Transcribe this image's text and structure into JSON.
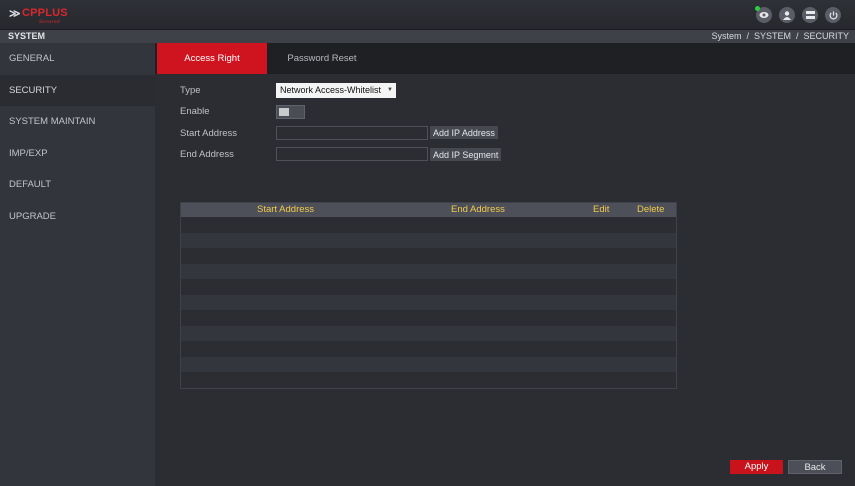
{
  "brand": {
    "logo_text": "CPPLUS",
    "logo_sub": "Secured"
  },
  "header": {
    "icons": [
      "eye-icon",
      "user-icon",
      "network-icon",
      "power-icon"
    ],
    "status_dot_color": "#2ecc40"
  },
  "titlebar": {
    "page_title": "SYSTEM",
    "breadcrumb": "System  /  SYSTEM  /  SECURITY"
  },
  "sidebar": {
    "items": [
      {
        "label": "GENERAL"
      },
      {
        "label": "SECURITY"
      },
      {
        "label": "SYSTEM MAINTAIN"
      },
      {
        "label": "IMP/EXP"
      },
      {
        "label": "DEFAULT"
      },
      {
        "label": "UPGRADE"
      }
    ],
    "active_index": 1
  },
  "tabs": [
    {
      "label": "Access Right",
      "active": true
    },
    {
      "label": "Password Reset",
      "active": false
    }
  ],
  "form": {
    "type_label": "Type",
    "type_value": "Network Access-Whitelist",
    "enable_label": "Enable",
    "enable_value": false,
    "start_label": "Start Address",
    "start_value": "",
    "end_label": "End Address",
    "end_value": "",
    "add_ip_address_label": "Add IP Address",
    "add_ip_segment_label": "Add IP Segment"
  },
  "table": {
    "columns": [
      "Start Address",
      "End Address",
      "Edit",
      "Delete"
    ],
    "rows": []
  },
  "footer": {
    "apply_label": "Apply",
    "back_label": "Back"
  },
  "colors": {
    "accent": "#cf1420",
    "header_text": "#f2c94c"
  }
}
